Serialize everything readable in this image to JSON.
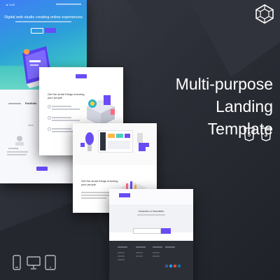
{
  "headline": {
    "line1": "Multi-purpose",
    "line2": "Landing Template"
  },
  "icons": {
    "brand": "geometric-cube-logo-icon",
    "html5": "html5-icon",
    "css3": "css3-icon",
    "phone": "phone-icon",
    "desktop": "desktop-icon",
    "tablet": "tablet-icon"
  },
  "mockups": {
    "hero_title": "Digital web studio creating online experiences",
    "section_title": "Portfolio",
    "features_title": "Get the smart things ensuring your people",
    "features2_title": "Get the smart things ensuring your people",
    "newsletter_title": "Subscribe to Newsletter"
  },
  "colors": {
    "accent": "#6a4cf5",
    "background": "#2b2e36",
    "text": "#ffffff"
  }
}
